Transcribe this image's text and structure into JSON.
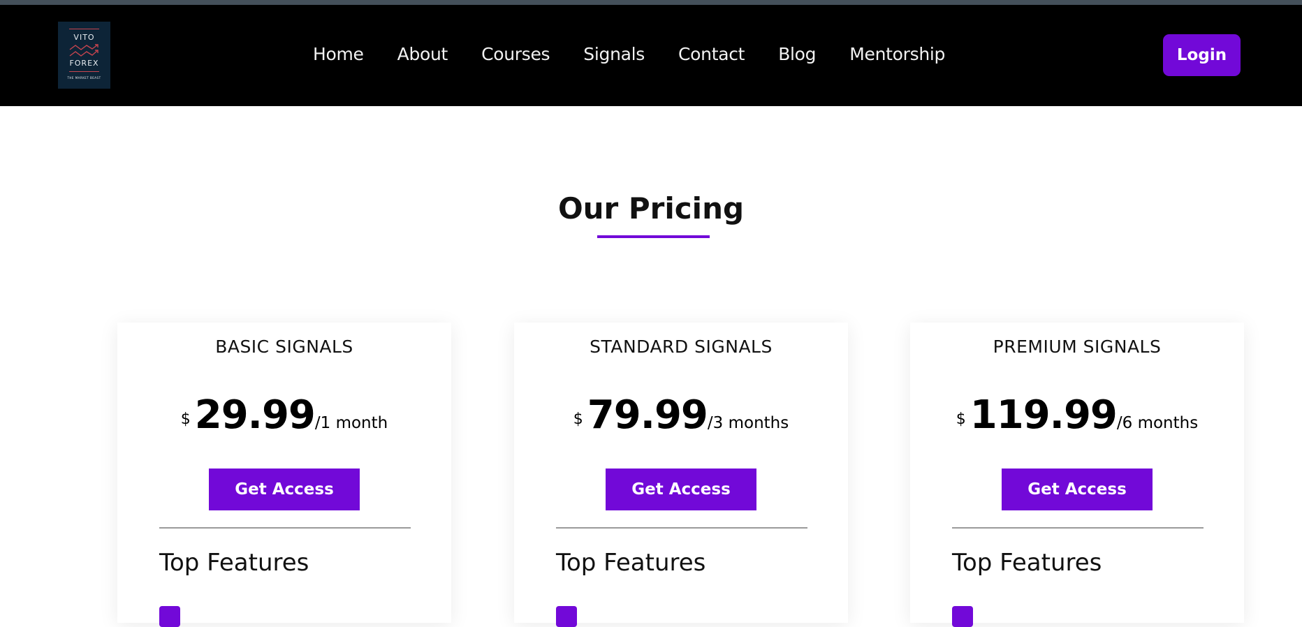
{
  "logo": {
    "line1": "VITO",
    "line2": "FOREX",
    "line3": "THE MARKET BEAST",
    "icon": "zigzag-arrows-icon"
  },
  "nav": {
    "items": [
      "Home",
      "About",
      "Courses",
      "Signals",
      "Contact",
      "Blog",
      "Mentorship"
    ]
  },
  "header": {
    "login_label": "Login"
  },
  "pricing": {
    "title": "Our Pricing",
    "cards": [
      {
        "name": "BASIC SIGNALS",
        "currency": "$",
        "amount": "29.99",
        "period": "/1 month",
        "cta": "Get Access",
        "features_title": "Top Features"
      },
      {
        "name": "STANDARD SIGNALS",
        "currency": "$",
        "amount": "79.99",
        "period": "/3 months",
        "cta": "Get Access",
        "features_title": "Top Features"
      },
      {
        "name": "PREMIUM SIGNALS",
        "currency": "$",
        "amount": "119.99",
        "period": "/6 months",
        "cta": "Get Access",
        "features_title": "Top Features"
      }
    ]
  },
  "colors": {
    "accent": "#7209d8",
    "header_bg": "#000000",
    "logo_bg": "#0d2437"
  }
}
